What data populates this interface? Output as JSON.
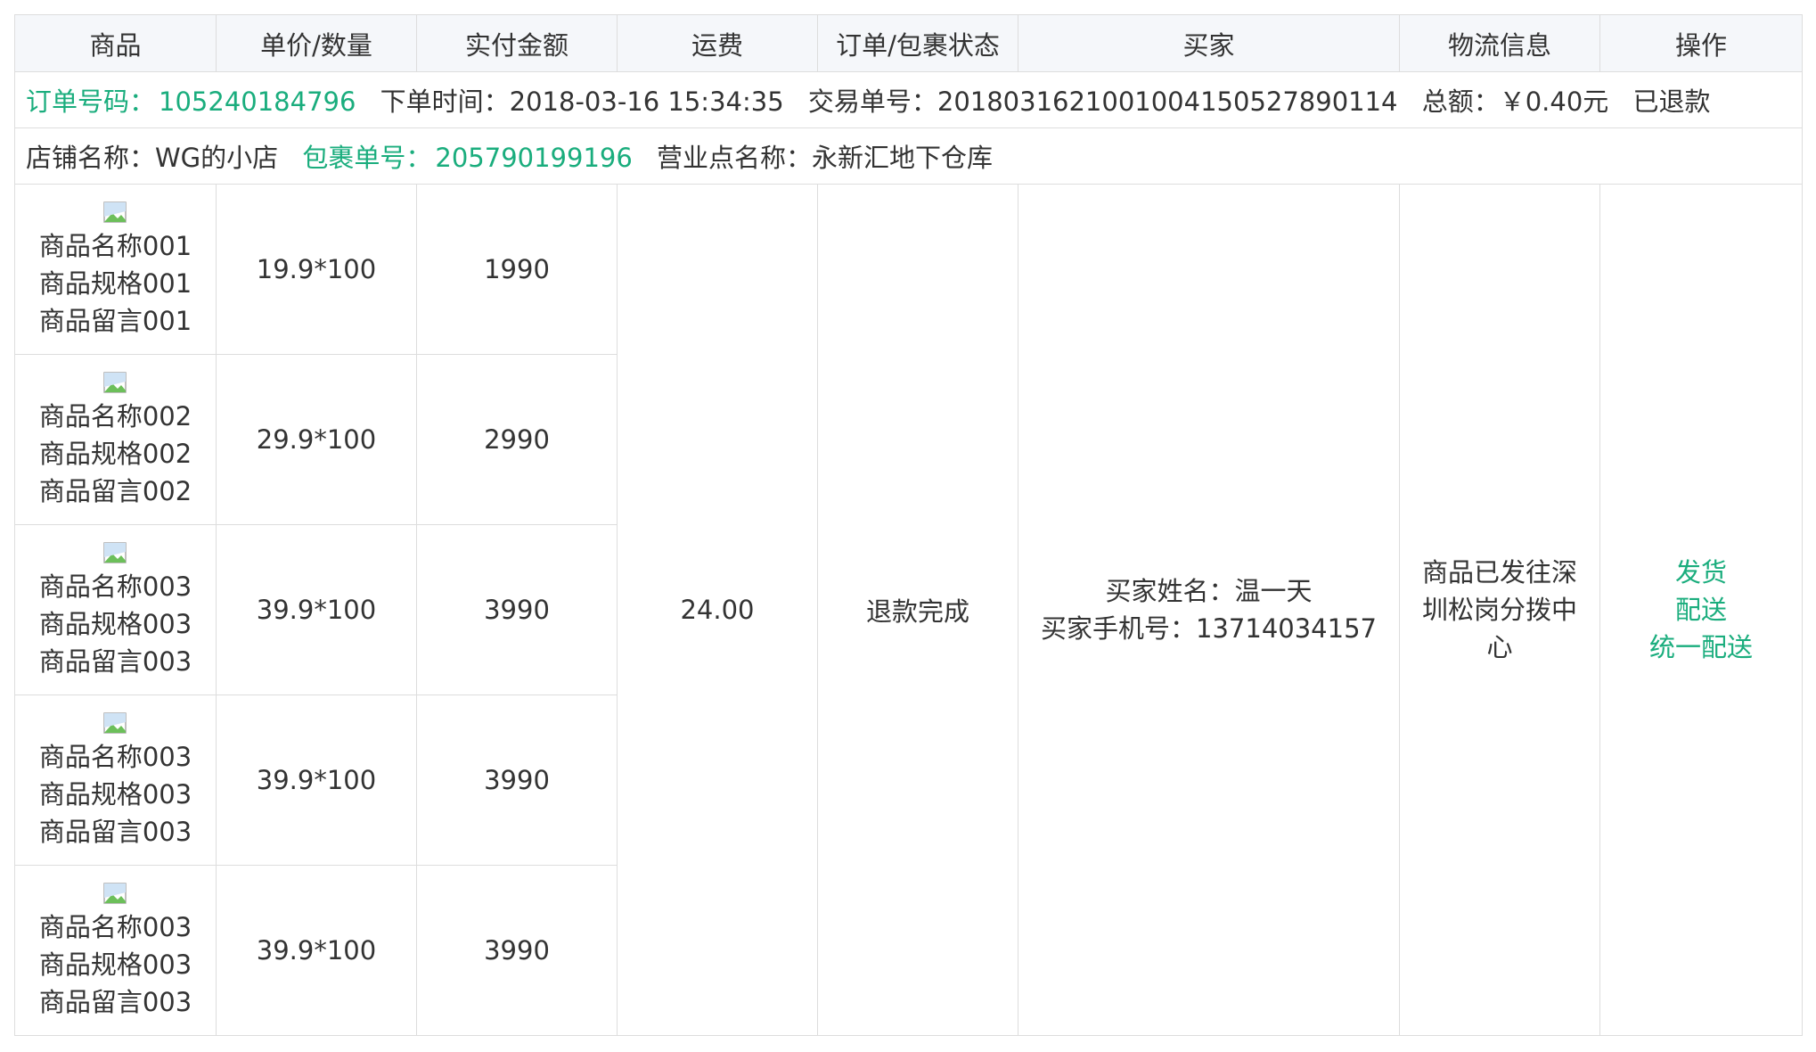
{
  "headers": [
    "商品",
    "单价/数量",
    "实付金额",
    "运费",
    "订单/包裹状态",
    "买家",
    "物流信息",
    "操作"
  ],
  "order": {
    "order_no_label": "订单号码：",
    "order_no": "105240184796",
    "time_text": "下单时间：2018-03-16 15:34:35",
    "trade_text": "交易单号：20180316210010041505278​90114",
    "total_text": "总额：￥0.40元",
    "status_text": "已退款"
  },
  "shop": {
    "shop_text": "店铺名称：WG的小店",
    "package_label": "包裹单号：",
    "package_no": "205790199196",
    "site_text": "营业点名称：永新汇地下仓库"
  },
  "items": [
    {
      "name": "商品名称001",
      "spec": "商品规格001",
      "note": "商品留言001",
      "price_qty": "19.9*100",
      "paid": "1990"
    },
    {
      "name": "商品名称002",
      "spec": "商品规格002",
      "note": "商品留言002",
      "price_qty": "29.9*100",
      "paid": "2990"
    },
    {
      "name": "商品名称003",
      "spec": "商品规格003",
      "note": "商品留言003",
      "price_qty": "39.9*100",
      "paid": "3990"
    },
    {
      "name": "商品名称003",
      "spec": "商品规格003",
      "note": "商品留言003",
      "price_qty": "39.9*100",
      "paid": "3990"
    },
    {
      "name": "商品名称003",
      "spec": "商品规格003",
      "note": "商品留言003",
      "price_qty": "39.9*100",
      "paid": "3990"
    }
  ],
  "freight": "24.00",
  "package_status": "退款完成",
  "buyer": {
    "name_text": "买家姓名：温一天",
    "phone_text": "买家手机号：13714034157"
  },
  "logistics": "商品已发往深圳松岗分拨中心",
  "actions": [
    "发货",
    "配送",
    "统一配送"
  ],
  "colors": {
    "accent": "#1aad7d",
    "header_bg": "#f5f7fa",
    "border": "#dddddd",
    "text": "#333333"
  }
}
